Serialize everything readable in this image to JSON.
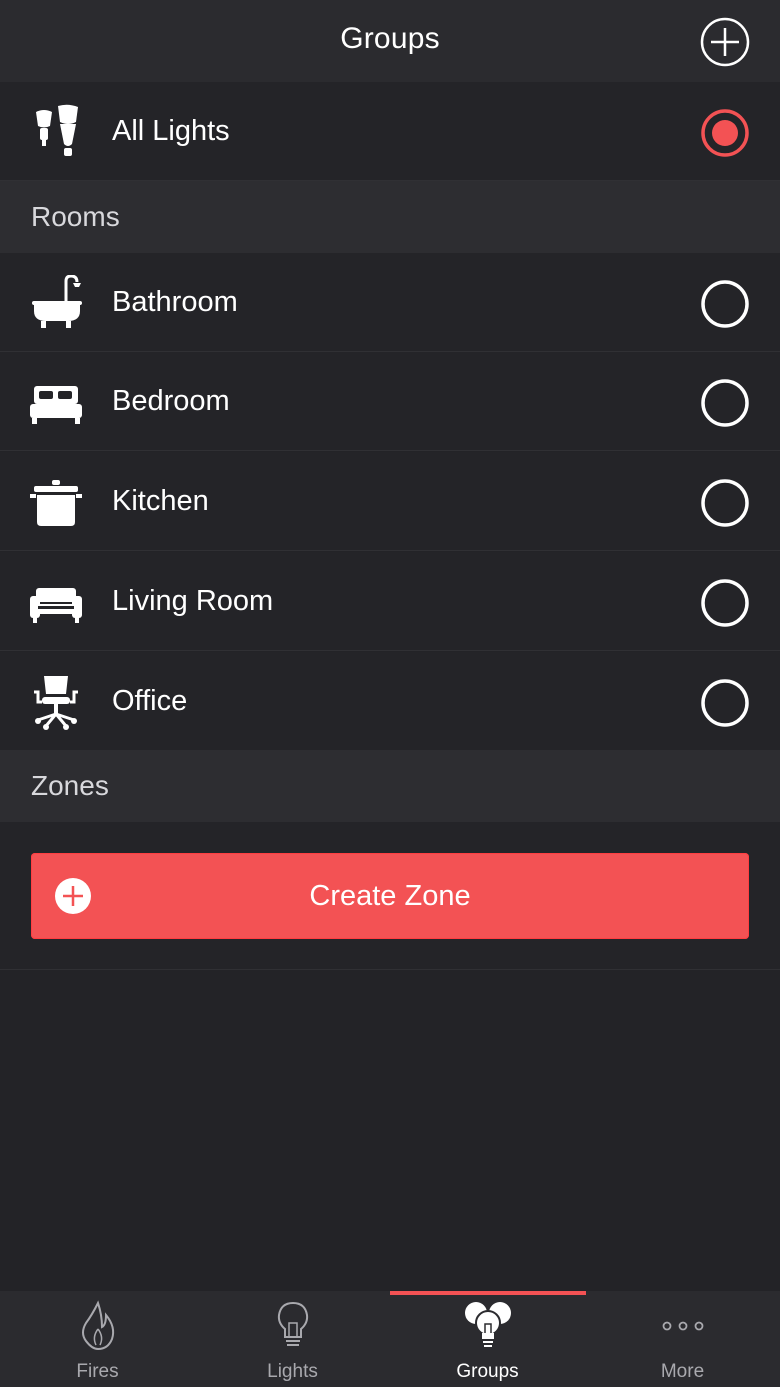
{
  "header": {
    "title": "Groups",
    "add_icon": "plus-circle-icon"
  },
  "all_lights": {
    "label": "All Lights",
    "icon": "lights-icon",
    "selected": true
  },
  "rooms_section": {
    "title": "Rooms"
  },
  "rooms": [
    {
      "label": "Bathroom",
      "icon": "bathtub-icon",
      "selected": false
    },
    {
      "label": "Bedroom",
      "icon": "bed-icon",
      "selected": false
    },
    {
      "label": "Kitchen",
      "icon": "pot-icon",
      "selected": false
    },
    {
      "label": "Living Room",
      "icon": "sofa-icon",
      "selected": false
    },
    {
      "label": "Office",
      "icon": "office-chair-icon",
      "selected": false
    }
  ],
  "zones_section": {
    "title": "Zones"
  },
  "create_zone": {
    "label": "Create Zone",
    "icon": "plus-circle-icon"
  },
  "tabs": [
    {
      "label": "Fires",
      "icon": "flame-icon",
      "active": false
    },
    {
      "label": "Lights",
      "icon": "bulb-icon",
      "active": false
    },
    {
      "label": "Groups",
      "icon": "bulbs-group-icon",
      "active": true
    },
    {
      "label": "More",
      "icon": "more-dots-icon",
      "active": false
    }
  ],
  "colors": {
    "accent": "#f35254",
    "background": "#242428",
    "header": "#2b2b2f",
    "section": "#2d2d31"
  }
}
